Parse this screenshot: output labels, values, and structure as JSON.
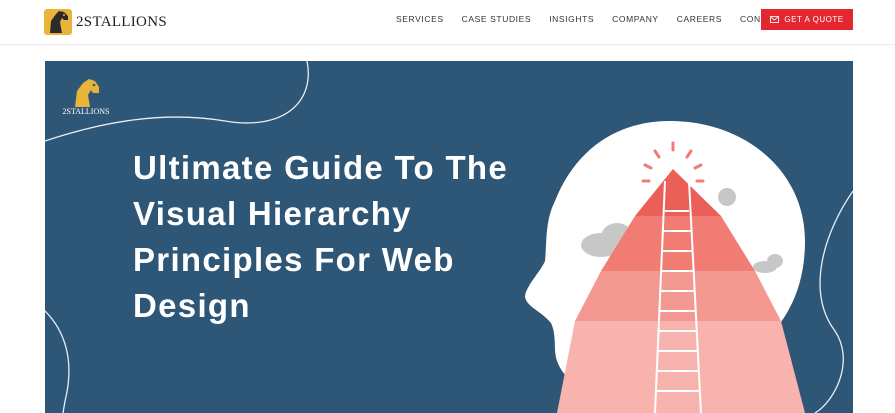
{
  "brand": {
    "name": "2STALLIONS"
  },
  "nav": {
    "items": [
      {
        "label": "SERVICES"
      },
      {
        "label": "CASE STUDIES"
      },
      {
        "label": "INSIGHTS"
      },
      {
        "label": "COMPANY"
      },
      {
        "label": "CAREERS"
      },
      {
        "label": "CONTACT US"
      }
    ],
    "cta_label": "GET A QUOTE",
    "cta_icon": "envelope-icon"
  },
  "hero": {
    "title": "Ultimate Guide To The Visual Hierarchy Principles For Web Design",
    "logo_text": "2STALLIONS",
    "illustration": "head-with-pyramid-illustration"
  },
  "colors": {
    "accent": "#e3262f",
    "hero_bg": "#2e5677",
    "pyramid": "#f07c74",
    "pyramid_light": "#f9b3ae",
    "logo_gold": "#e8b53a"
  }
}
